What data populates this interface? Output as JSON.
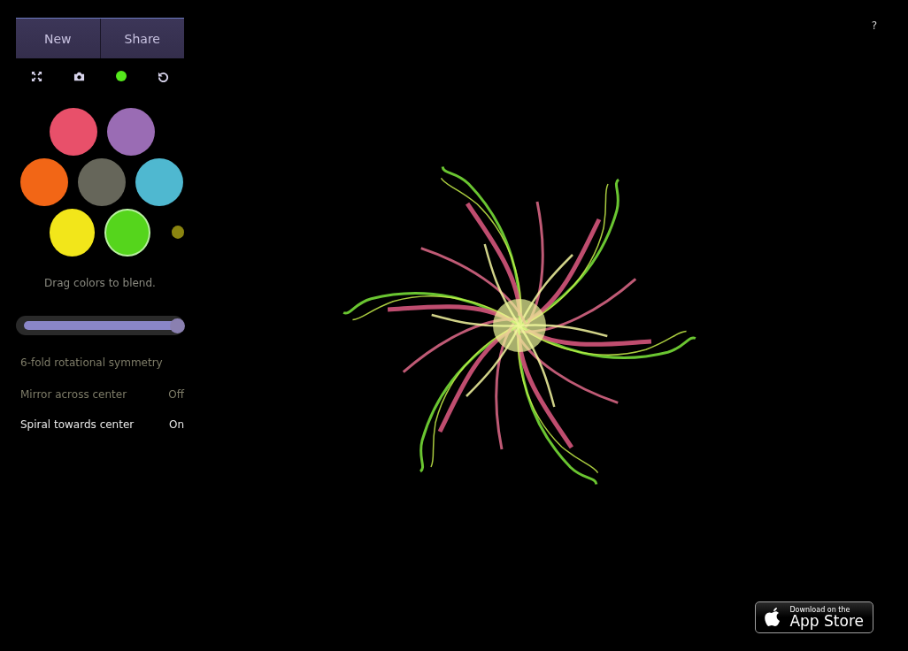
{
  "buttons": [
    {
      "label": "New"
    },
    {
      "label": "Share"
    }
  ],
  "tools": [
    {
      "kind": "fullscreen"
    },
    {
      "kind": "camera"
    },
    {
      "kind": "dot",
      "color": "#55e81c"
    },
    {
      "kind": "undo"
    }
  ],
  "swatches": [
    {
      "color": "#e8506a",
      "selected": false
    },
    {
      "color": "#9a6cb4",
      "selected": false
    },
    {
      "color": "#f26616",
      "selected": false
    },
    {
      "color": "#66665a",
      "selected": false
    },
    {
      "color": "#4fb8d0",
      "selected": false
    },
    {
      "color": "#f2e61a",
      "selected": false
    },
    {
      "color": "#55d51c",
      "selected": true
    }
  ],
  "blend_dot": {
    "color": "#8a8410"
  },
  "hint": "Drag colors to blend.",
  "symmetry_slider": {
    "level": 1.0
  },
  "symmetry_label": "6-fold rotational symmetry",
  "toggles": [
    {
      "label": "Mirror across center",
      "value": "Off",
      "on": false
    },
    {
      "label": "Spiral towards center",
      "value": "On",
      "on": true
    }
  ],
  "help": "?",
  "app_store": {
    "small": "Download on the",
    "big": "App Store"
  }
}
